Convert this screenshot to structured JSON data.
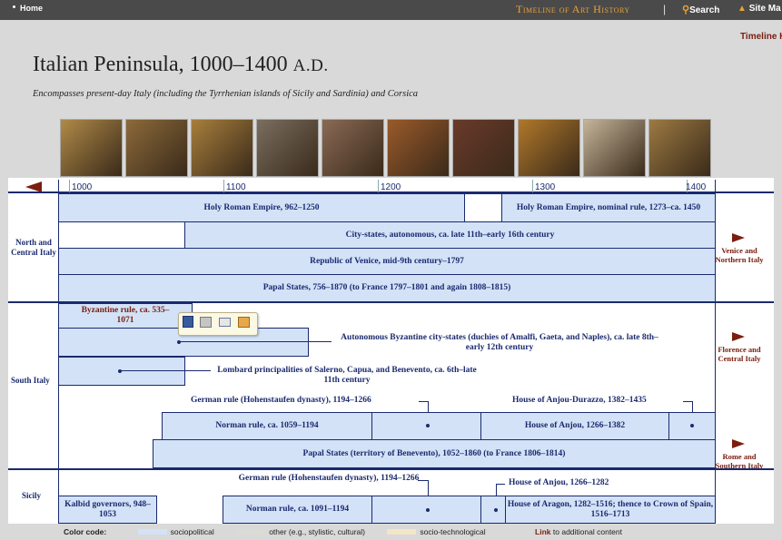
{
  "nav": {
    "home": "Home",
    "site_title": "Timeline of Art History",
    "separator": "|",
    "search": "Search",
    "site_map": "Site Ma",
    "timeline_link": "Timeline H"
  },
  "header": {
    "title": "Italian Peninsula, 1000–1400",
    "title_suffix": "A.D.",
    "subtitle": "Encompasses present-day Italy (including the Tyrrhenian islands of Sicily and Sardinia) and Corsica"
  },
  "thumbnails": [
    {
      "color": "#b08a48"
    },
    {
      "color": "#8c6a3a"
    },
    {
      "color": "#a77f3c"
    },
    {
      "color": "#7a6e60"
    },
    {
      "color": "#8a6a55"
    },
    {
      "color": "#9a5a2a"
    },
    {
      "color": "#6a3a2a"
    },
    {
      "color": "#b0782a"
    },
    {
      "color": "#c4b59a"
    },
    {
      "color": "#9c7a42"
    }
  ],
  "years": [
    "1000",
    "1100",
    "1200",
    "1300",
    "1400"
  ],
  "regions": {
    "north": "North and Central Italy",
    "south": "South Italy",
    "sicily": "Sicily"
  },
  "right_links": {
    "venice": "Venice and Northern Italy",
    "florence": "Florence and Central Italy",
    "rome": "Rome and Southern Italy"
  },
  "rows": {
    "hre": "Holy Roman Empire, 962–1250",
    "hre_nominal": "Holy Roman Empire, nominal rule, 1273–ca. 1450",
    "city_states": "City-states, autonomous, ca. late 11th–early 16th century",
    "venice": "Republic of Venice, mid-9th century–1797",
    "papal_north": "Papal States, 756–1870 (to France 1797–1801 and again 1808–1815)",
    "byzantine": "Byzantine rule, ca. 535–1071",
    "byz_city_states": "Autonomous Byzantine city-states (duchies of Amalfi, Gaeta, and Naples), ca. late 8th–early 12th century",
    "lombard": "Lombard principalities of Salerno, Capua, and Benevento, ca. 6th–late 11th century",
    "german_south": "German rule (Hohenstaufen dynasty), 1194–1266",
    "anjou_durazzo": "House of Anjou-Durazzo, 1382–1435",
    "norman_south": "Norman rule, ca. 1059–1194",
    "anjou_south": "House of Anjou, 1266–1382",
    "papal_benevento": "Papal States (territory of Benevento), 1052–1860 (to France 1806–1814)",
    "german_sicily": "German rule (Hohenstaufen dynasty), 1194–1266",
    "anjou_sicily": "House of Anjou, 1266–1282",
    "kalbid": "Kalbid governors, 948–1053",
    "norman_sicily": "Norman rule, ca. 1091–1194",
    "aragon": "House of Aragon, 1282–1516; thence to Crown of Spain, 1516–1713"
  },
  "legend": {
    "title": "Color code:",
    "sociopolitical": "sociopolitical",
    "other": "other (e.g., stylistic, cultural)",
    "socio_tech": "socio-technological",
    "link": "Link",
    "link_rest": "to additional content"
  },
  "colors": {
    "sociopolitical": "#d3e2f7",
    "other": "#d8dcd4",
    "socio_tech": "#f3e6c6",
    "accent": "#7a1e10",
    "border": "#1a2a6e"
  }
}
